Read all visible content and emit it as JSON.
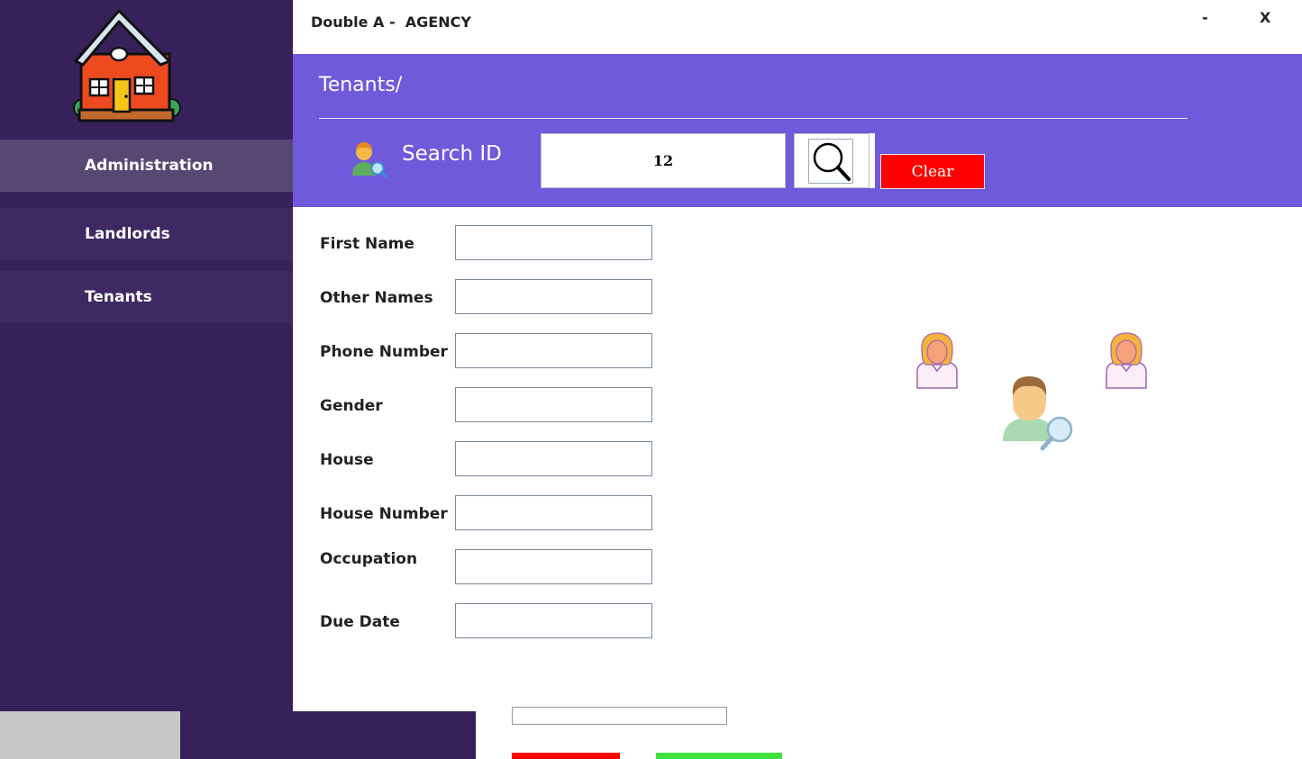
{
  "window": {
    "title": "Double A -  AGENCY",
    "minimize_label": "-",
    "close_label": "X"
  },
  "sidebar": {
    "items": [
      {
        "label": "Administration"
      },
      {
        "label": "Landlords"
      },
      {
        "label": "Tenants"
      }
    ]
  },
  "header": {
    "heading": "Tenants/",
    "search_label": "Search ID",
    "search_value": "12",
    "clear_label": "Clear"
  },
  "form": {
    "fields": [
      {
        "label": "First Name",
        "value": ""
      },
      {
        "label": "Other Names",
        "value": ""
      },
      {
        "label": "Phone Number",
        "value": ""
      },
      {
        "label": "Gender",
        "value": ""
      },
      {
        "label": "House",
        "value": ""
      },
      {
        "label": "House Number",
        "value": ""
      },
      {
        "label": "Occupation",
        "value": ""
      },
      {
        "label": "Due Date",
        "value": ""
      }
    ]
  },
  "icons": {
    "logo": "house-logo-icon",
    "search_user": "user-search-icon",
    "search_button": "magnifier-icon",
    "illustration": "people-search-icon"
  },
  "colors": {
    "sidebar": "#36215a",
    "sidebar_active": "#574873",
    "header_band": "#6e5adb",
    "clear_button": "#ff0000"
  }
}
